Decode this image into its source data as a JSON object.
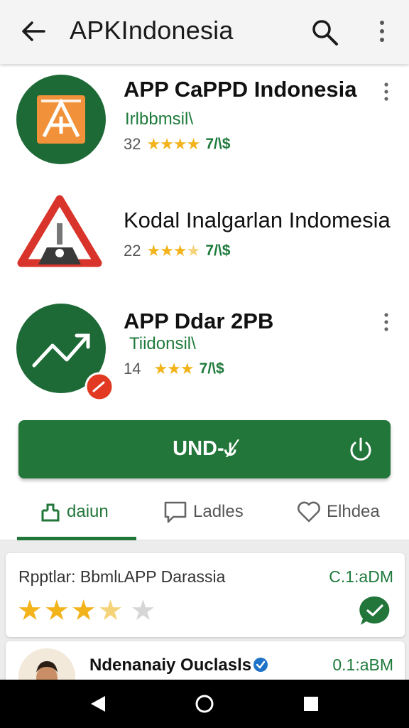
{
  "appbar": {
    "title": "APKIndonesia",
    "back_icon": "arrow-back-icon",
    "search_icon": "search-icon",
    "more_icon": "more-vert-icon"
  },
  "apps": [
    {
      "name": "APP CaPPD Indonesia",
      "developer": "Irlbbmsil\\",
      "rating_count": "32",
      "stars": "★★★★",
      "price": "7/\\$",
      "icon": "orange-a-app-icon"
    },
    {
      "name": "Kodal Inalgarlan Indomesia",
      "developer": "",
      "rating_count": "22",
      "stars_full": "★★★",
      "stars_half": "★",
      "price": "7/\\$",
      "icon": "red-triangle-app-icon"
    },
    {
      "name": "APP Ddar 2PB",
      "developer": "Tiidonsil\\",
      "rating_count": "14",
      "stars": "★★★",
      "price": "7/\\$",
      "icon": "green-chart-app-icon"
    }
  ],
  "install": {
    "label": "UND-⫝̸",
    "icon": "power-icon"
  },
  "tabs": [
    {
      "label": "daiun",
      "icon": "share-icon",
      "active": true
    },
    {
      "label": "Ladles",
      "icon": "comment-icon",
      "active": false
    },
    {
      "label": "Elhdea",
      "icon": "heart-icon",
      "active": false
    }
  ],
  "reviews": [
    {
      "title": "Rpptlar: BbmlʟAPP Darassia",
      "time": "C.1:aDM",
      "rating": 3.5,
      "stars_full": "★★★",
      "stars_half": "★",
      "stars_empty": "★",
      "icon": "chat-bubble-icon"
    },
    {
      "name": "Ndenanaiy Ouclasls",
      "time": "0.1:aBM",
      "icon": "verified-badge-icon"
    }
  ],
  "navbar": {
    "back": "nav-back-icon",
    "home": "nav-home-icon",
    "recents": "nav-recents-icon"
  },
  "colors": {
    "accent": "#22763a",
    "star": "#f2b31b",
    "dev_text": "#1e7a3b"
  }
}
